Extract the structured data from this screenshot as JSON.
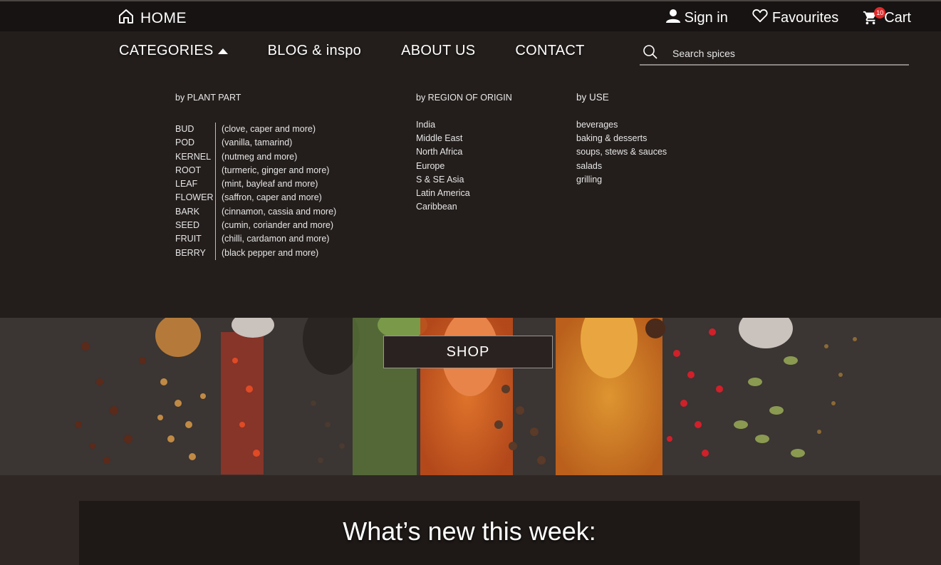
{
  "topbar": {
    "home_label": "HOME",
    "signin_label": "Sign in",
    "favourites_label": "Favourites",
    "cart_label": "Cart",
    "cart_count": "10"
  },
  "nav": {
    "categories": "CATEGORIES",
    "blog": "BLOG & inspo",
    "about": "ABOUT US",
    "contact": "CONTACT"
  },
  "search": {
    "placeholder": "Search spices"
  },
  "menu": {
    "plant_title": "by PLANT PART",
    "region_title": "by REGION OF ORIGIN",
    "use_title": "by USE",
    "plant_parts": [
      {
        "name": "BUD",
        "desc": "(clove, caper and more)"
      },
      {
        "name": "POD",
        "desc": "(vanilla, tamarind)"
      },
      {
        "name": "KERNEL",
        "desc": "(nutmeg and more)"
      },
      {
        "name": "ROOT",
        "desc": "(turmeric, ginger and more)"
      },
      {
        "name": "LEAF",
        "desc": "(mint, bayleaf and more)"
      },
      {
        "name": "FLOWER",
        "desc": "(saffron, caper and more)"
      },
      {
        "name": "BARK",
        "desc": "(cinnamon, cassia and more)"
      },
      {
        "name": "SEED",
        "desc": "(cumin, coriander and more)"
      },
      {
        "name": "FRUIT",
        "desc": "(chilli, cardamon and more)"
      },
      {
        "name": "BERRY",
        "desc": "(black pepper and more)"
      }
    ],
    "regions": [
      "India",
      "Middle East",
      "North Africa",
      "Europe",
      "S & SE Asia",
      "Latin America",
      "Caribbean"
    ],
    "uses": [
      "beverages",
      "baking & desserts",
      "soups, stews & sauces",
      "salads",
      "grilling"
    ]
  },
  "hero": {
    "shop_label": "SHOP"
  },
  "section": {
    "whats_new": "What’s new this week:"
  },
  "colors": {
    "badge": "#e02a2a",
    "topbar_bg": "#171312",
    "menu_bg": "#231e1c"
  }
}
